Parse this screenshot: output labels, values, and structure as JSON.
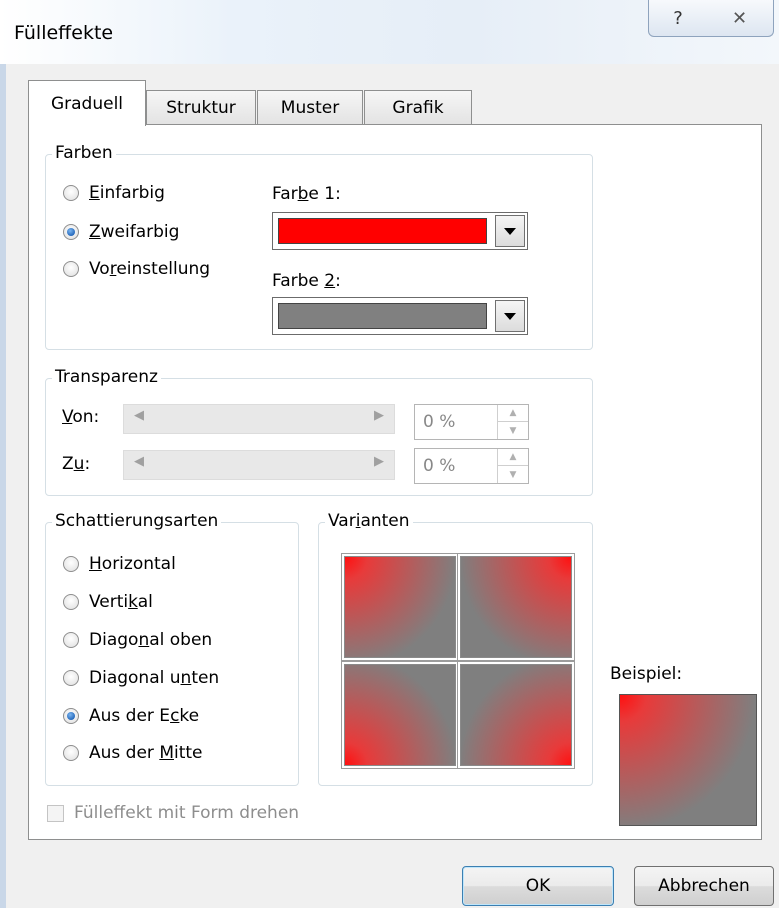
{
  "window": {
    "title": "Fülleffekte",
    "help_glyph": "?",
    "close_glyph": "✕"
  },
  "tabs": [
    {
      "label": "Graduell",
      "active": true
    },
    {
      "label": "Struktur",
      "active": false
    },
    {
      "label": "Muster",
      "active": false
    },
    {
      "label": "Grafik",
      "active": false
    }
  ],
  "farben": {
    "legend": "Farben",
    "options": [
      {
        "pre": "",
        "u": "E",
        "post": "infarbig",
        "checked": false
      },
      {
        "pre": "",
        "u": "Z",
        "post": "weifarbig",
        "checked": true
      },
      {
        "pre": "Vo",
        "u": "r",
        "post": "einstellung",
        "checked": false
      }
    ],
    "farbe1": {
      "pre": "Far",
      "u": "b",
      "post": "e 1:",
      "color": "#ff0000"
    },
    "farbe2": {
      "pre": "Farbe ",
      "u": "2",
      "post": ":",
      "color": "#808080"
    }
  },
  "transparenz": {
    "legend": "Transparenz",
    "von": {
      "u": "V",
      "post": "on:",
      "value": "0 %"
    },
    "zu": {
      "pre": "Z",
      "u": "u",
      "post": ":",
      "value": "0 %"
    }
  },
  "schattierung": {
    "legend": "Schattierungsarten",
    "options": [
      {
        "pre": "",
        "u": "H",
        "post": "orizontal",
        "checked": false
      },
      {
        "pre": "Verti",
        "u": "k",
        "post": "al",
        "checked": false
      },
      {
        "pre": "Diago",
        "u": "n",
        "post": "al oben",
        "checked": false
      },
      {
        "pre": "Diagonal u",
        "u": "n",
        "post": "ten",
        "checked": false
      },
      {
        "pre": "Aus der E",
        "u": "c",
        "post": "ke",
        "checked": true
      },
      {
        "pre": "Aus der ",
        "u": "M",
        "post": "itte",
        "checked": false
      }
    ]
  },
  "varianten": {
    "pre": "Var",
    "u": "i",
    "post": "anten"
  },
  "beispiel_label": "Beispiel:",
  "checkbox_label": "Fülleffekt mit Form drehen",
  "buttons": {
    "ok": "OK",
    "cancel": "Abbrechen"
  },
  "colors": {
    "red": "#ff0000",
    "gray": "#808080",
    "accent": "#1b5fb5"
  }
}
